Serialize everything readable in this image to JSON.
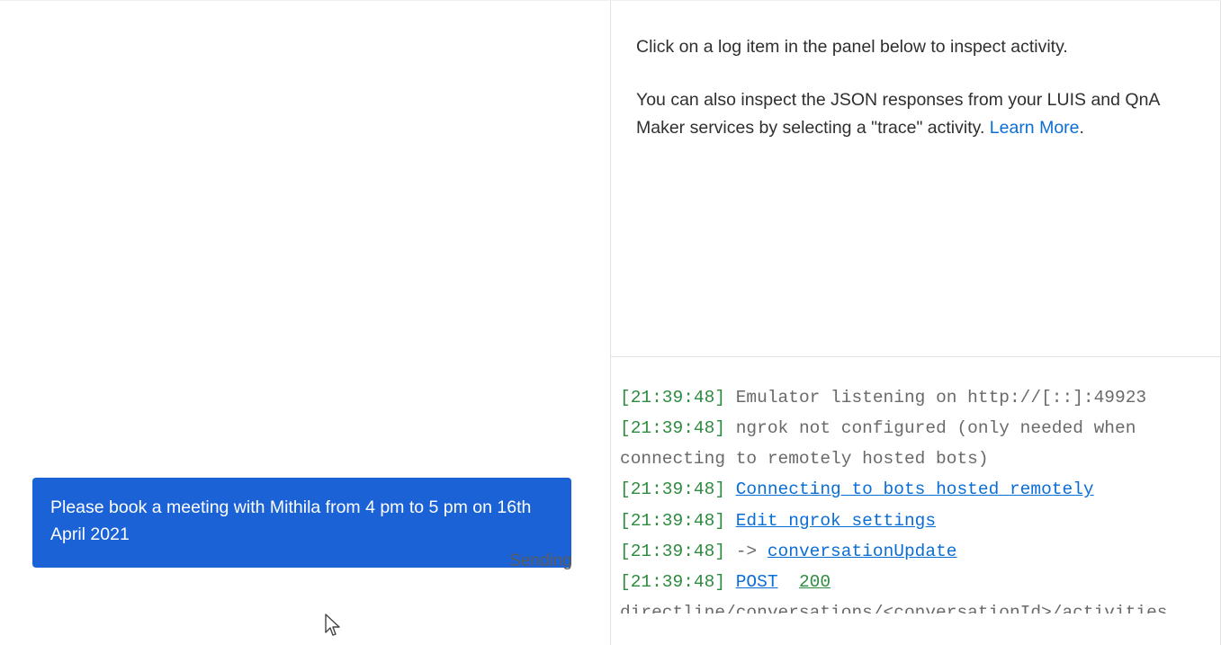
{
  "chat": {
    "user_message": "Please book a meeting with Mithila from 4 pm to 5 pm on 16th April 2021",
    "status": "Sending"
  },
  "inspector": {
    "line1": "Click on a log item in the panel below to inspect activity.",
    "line2_pre": "You can also inspect the JSON responses from your LUIS and QnA Maker services by selecting a \"trace\" activity. ",
    "learn_more": "Learn More",
    "line2_post": "."
  },
  "log": {
    "entries": [
      {
        "ts": "21:39:48",
        "type": "text",
        "text": "Emulator listening on http://[::]:49923"
      },
      {
        "ts": "21:39:48",
        "type": "text",
        "text": "ngrok not configured (only needed when connecting to remotely hosted bots)"
      },
      {
        "ts": "21:39:48",
        "type": "link",
        "text": "Connecting to bots hosted remotely"
      },
      {
        "ts": "21:39:48",
        "type": "link",
        "text": "Edit ngrok settings"
      },
      {
        "ts": "21:39:48",
        "type": "arrowlink",
        "arrow": "->",
        "text": "conversationUpdate"
      },
      {
        "ts": "21:39:48",
        "type": "poststatus",
        "method": "POST",
        "status": "200"
      }
    ],
    "cutoff": "directline/conversations/<conversationId>/activities"
  }
}
